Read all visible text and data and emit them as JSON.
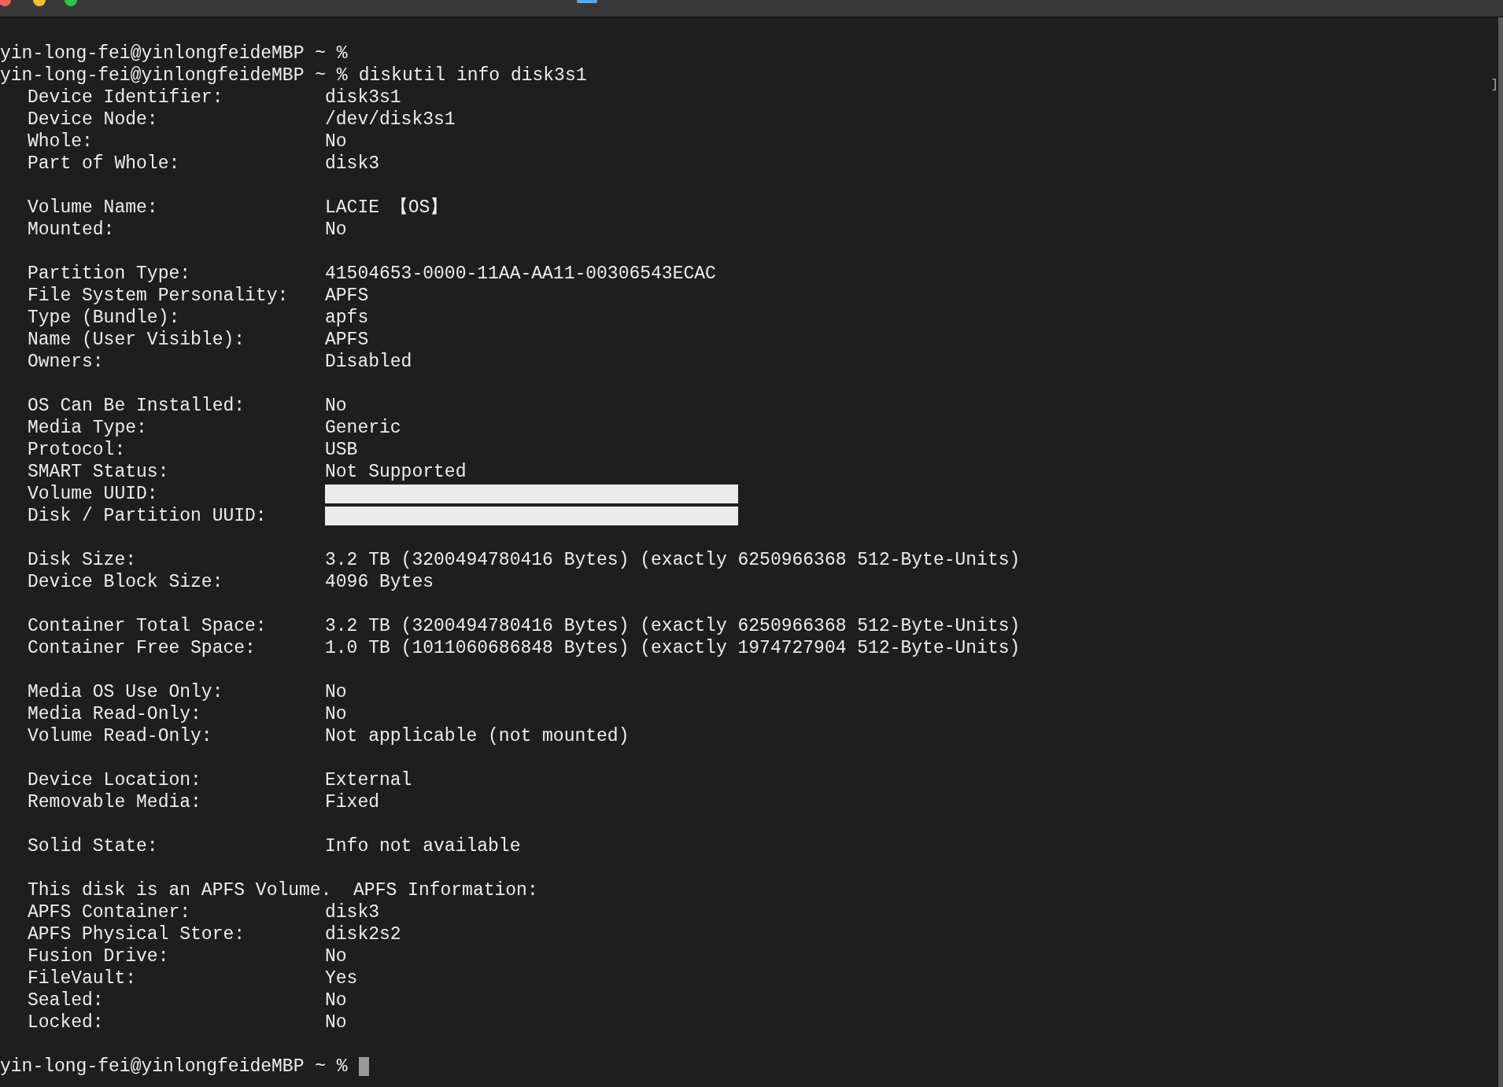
{
  "terminal": {
    "edge_mark": "]",
    "lines": [
      {
        "kind": "prompt",
        "prompt": "yin-long-fei@yinlongfeideMBP ~ %"
      },
      {
        "kind": "prompt",
        "prompt": "yin-long-fei@yinlongfeideMBP ~ %",
        "command": "diskutil info disk3s1"
      },
      {
        "kind": "field",
        "label": "Device Identifier:",
        "value": "disk3s1"
      },
      {
        "kind": "field",
        "label": "Device Node:",
        "value": "/dev/disk3s1"
      },
      {
        "kind": "field",
        "label": "Whole:",
        "value": "No"
      },
      {
        "kind": "field",
        "label": "Part of Whole:",
        "value": "disk3"
      },
      {
        "kind": "blank"
      },
      {
        "kind": "field",
        "label": "Volume Name:",
        "value": "LACIE 【OS】"
      },
      {
        "kind": "field",
        "label": "Mounted:",
        "value": "No"
      },
      {
        "kind": "blank"
      },
      {
        "kind": "field",
        "label": "Partition Type:",
        "value": "41504653-0000-11AA-AA11-00306543ECAC"
      },
      {
        "kind": "field",
        "label": "File System Personality:",
        "value": "APFS"
      },
      {
        "kind": "field",
        "label": "Type (Bundle):",
        "value": "apfs"
      },
      {
        "kind": "field",
        "label": "Name (User Visible):",
        "value": "APFS"
      },
      {
        "kind": "field",
        "label": "Owners:",
        "value": "Disabled"
      },
      {
        "kind": "blank"
      },
      {
        "kind": "field",
        "label": "OS Can Be Installed:",
        "value": "No"
      },
      {
        "kind": "field",
        "label": "Media Type:",
        "value": "Generic"
      },
      {
        "kind": "field",
        "label": "Protocol:",
        "value": "USB"
      },
      {
        "kind": "field",
        "label": "SMART Status:",
        "value": "Not Supported"
      },
      {
        "kind": "redacted",
        "label": "Volume UUID:"
      },
      {
        "kind": "redacted",
        "label": "Disk / Partition UUID:"
      },
      {
        "kind": "blank"
      },
      {
        "kind": "field",
        "label": "Disk Size:",
        "value": "3.2 TB (3200494780416 Bytes) (exactly 6250966368 512-Byte-Units)"
      },
      {
        "kind": "field",
        "label": "Device Block Size:",
        "value": "4096 Bytes"
      },
      {
        "kind": "blank"
      },
      {
        "kind": "field",
        "label": "Container Total Space:",
        "value": "3.2 TB (3200494780416 Bytes) (exactly 6250966368 512-Byte-Units)"
      },
      {
        "kind": "field",
        "label": "Container Free Space:",
        "value": "1.0 TB (1011060686848 Bytes) (exactly 1974727904 512-Byte-Units)"
      },
      {
        "kind": "blank"
      },
      {
        "kind": "field",
        "label": "Media OS Use Only:",
        "value": "No"
      },
      {
        "kind": "field",
        "label": "Media Read-Only:",
        "value": "No"
      },
      {
        "kind": "field",
        "label": "Volume Read-Only:",
        "value": "Not applicable (not mounted)"
      },
      {
        "kind": "blank"
      },
      {
        "kind": "field",
        "label": "Device Location:",
        "value": "External"
      },
      {
        "kind": "field",
        "label": "Removable Media:",
        "value": "Fixed"
      },
      {
        "kind": "blank"
      },
      {
        "kind": "field",
        "label": "Solid State:",
        "value": "Info not available"
      },
      {
        "kind": "blank"
      },
      {
        "kind": "text",
        "text": "This disk is an APFS Volume.  APFS Information:"
      },
      {
        "kind": "field",
        "label": "APFS Container:",
        "value": "disk3"
      },
      {
        "kind": "field",
        "label": "APFS Physical Store:",
        "value": "disk2s2"
      },
      {
        "kind": "field",
        "label": "Fusion Drive:",
        "value": "No"
      },
      {
        "kind": "field",
        "label": "FileVault:",
        "value": "Yes"
      },
      {
        "kind": "field",
        "label": "Sealed:",
        "value": "No"
      },
      {
        "kind": "field",
        "label": "Locked:",
        "value": "No"
      },
      {
        "kind": "blank"
      },
      {
        "kind": "prompt",
        "prompt": "yin-long-fei@yinlongfeideMBP ~ %",
        "cursor": true
      }
    ]
  }
}
